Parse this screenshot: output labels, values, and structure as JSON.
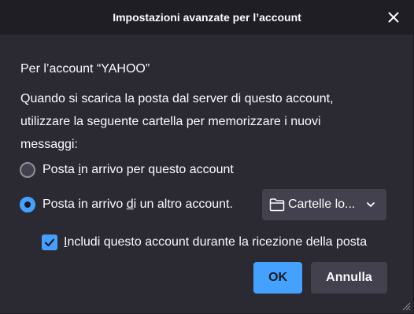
{
  "dialog": {
    "title": "Impostazioni avanzate per l’account",
    "close_icon": "close-icon"
  },
  "account_line": "Per l’account “YAHOO”",
  "description": [
    "Quando si scarica la posta dal server di questo account,",
    "utilizzare la seguente cartella per memorizzare i nuovi",
    "messaggi:"
  ],
  "options": {
    "inbox_this_account": {
      "label_before": "Posta ",
      "label_access": "i",
      "label_after": "n arrivo per questo account",
      "selected": false
    },
    "inbox_other_account": {
      "label_before": "Posta in arrivo ",
      "label_access": "d",
      "label_after": "i un altro account.",
      "selected": true
    }
  },
  "folder_select": {
    "value": "Cartelle lo...",
    "icon": "folder-icon"
  },
  "include_checkbox": {
    "label_before": "",
    "label_access": "I",
    "label_after": "ncludi questo account durante la ricezione della posta",
    "checked": true
  },
  "buttons": {
    "ok": "OK",
    "cancel": "Annulla"
  },
  "colors": {
    "background": "#2b2a33",
    "accent": "#45a1ff",
    "control": "#42414d",
    "text": "#fbfbfe"
  }
}
